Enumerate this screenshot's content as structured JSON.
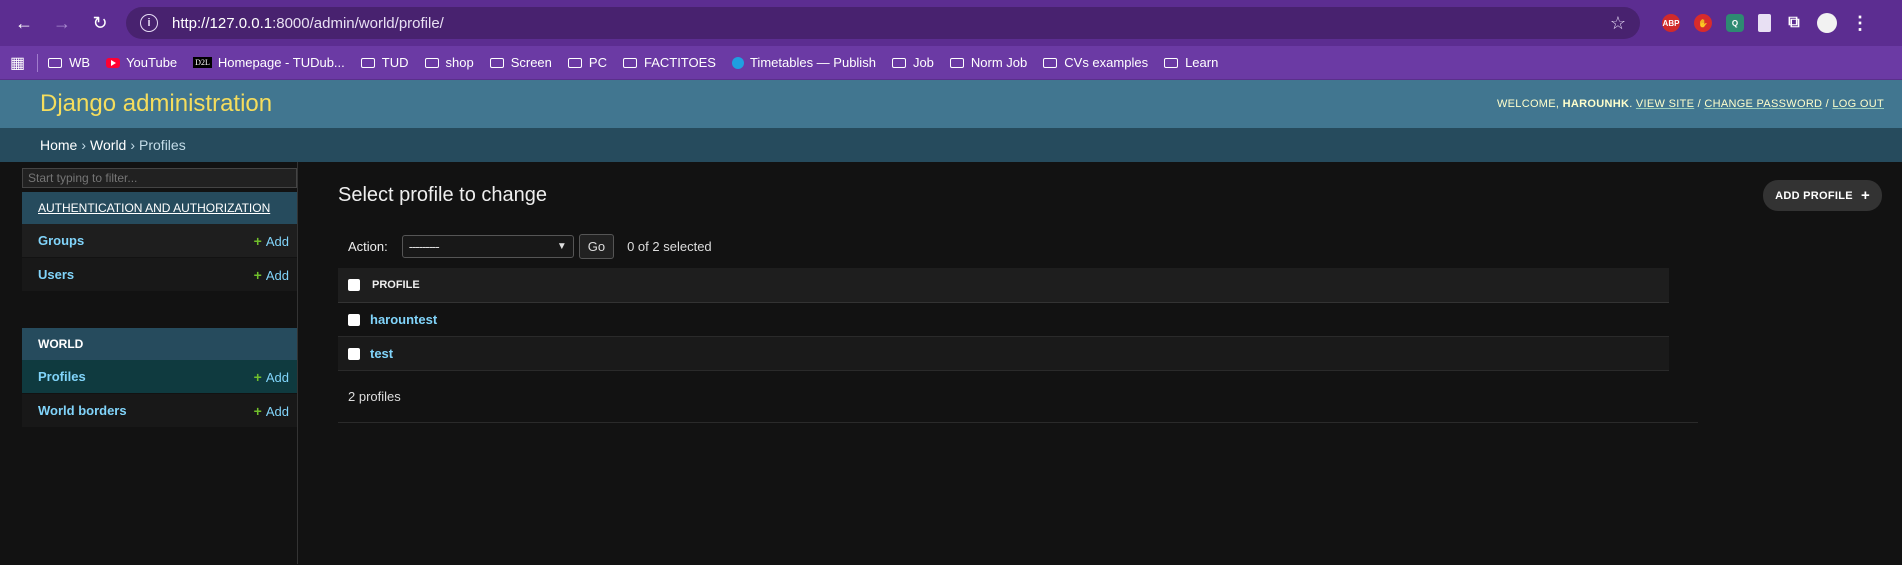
{
  "browser": {
    "url_host": "http://127.0.0.1",
    "url_rest": ":8000/admin/world/profile/",
    "bookmarks": [
      "WB",
      "YouTube",
      "Homepage - TUDub...",
      "TUD",
      "shop",
      "Screen",
      "PC",
      "FACTITOES",
      "Timetables — Publish",
      "Job",
      "Norm Job",
      "CVs examples",
      "Learn"
    ],
    "d2l_label": "D2L",
    "ext_abp": "ABP"
  },
  "header": {
    "brand": "Django administration",
    "welcome": "Welcome,",
    "username": "harounhk",
    "view_site": "View site",
    "change_password": "Change password",
    "log_out": "Log out"
  },
  "breadcrumbs": {
    "home": "Home",
    "app": "World",
    "current": "Profiles",
    "separator": "›"
  },
  "sidebar": {
    "filter_placeholder": "Start typing to filter...",
    "add_label": "Add",
    "modules": [
      {
        "caption": "Authentication and Authorization",
        "models": [
          "Groups",
          "Users"
        ]
      },
      {
        "caption": "World",
        "models": [
          "Profiles",
          "World borders"
        ]
      }
    ]
  },
  "content": {
    "title": "Select profile to change",
    "add_button": "Add profile",
    "action_label": "Action:",
    "action_selected": "---------",
    "go_button": "Go",
    "counter": "0 of 2 selected",
    "column_header": "Profile",
    "rows": [
      "harountest",
      "test"
    ],
    "paginator": "2 profiles"
  },
  "colors": {
    "header_bg": "#417690",
    "breadcrumb_bg": "#264b5d",
    "brand": "#f5dd5d",
    "link": "#81d4fa",
    "add_plus": "#70bf2b",
    "browser_bar": "#5c2d91"
  }
}
